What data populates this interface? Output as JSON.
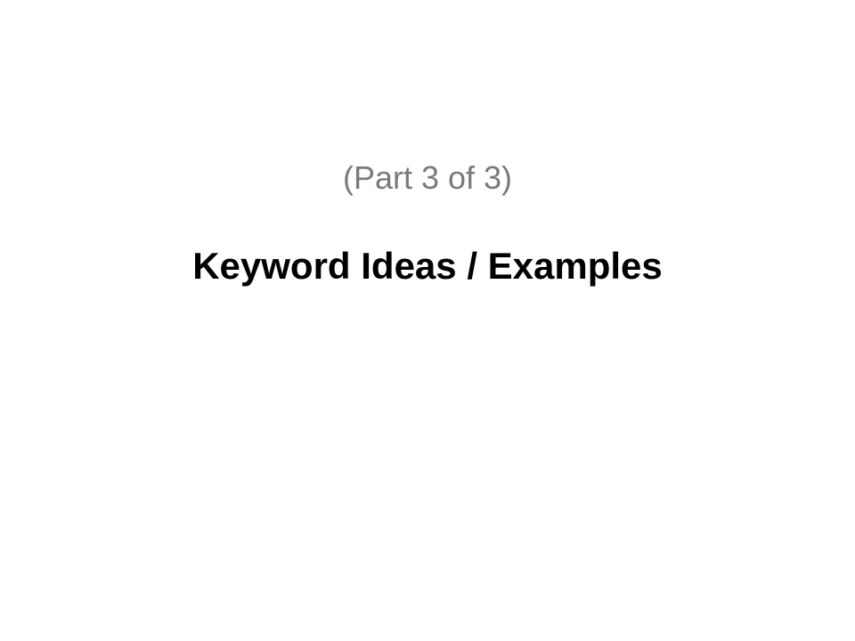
{
  "slide": {
    "subtitle": "(Part 3 of 3)",
    "title": "Keyword Ideas / Examples",
    "colors": {
      "background": "#ffffff",
      "subtitle": "#7a7a7a",
      "title": "#000000"
    }
  }
}
